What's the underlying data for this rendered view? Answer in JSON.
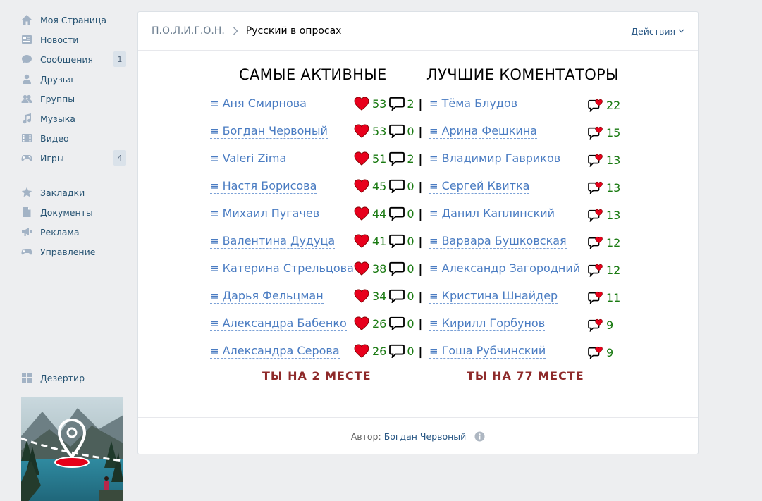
{
  "sidebar": {
    "items": [
      {
        "label": "Моя Страница",
        "icon": "home-icon"
      },
      {
        "label": "Новости",
        "icon": "news-icon"
      },
      {
        "label": "Сообщения",
        "icon": "messages-icon",
        "count": "1"
      },
      {
        "label": "Друзья",
        "icon": "friends-icon"
      },
      {
        "label": "Группы",
        "icon": "groups-icon"
      },
      {
        "label": "Музыка",
        "icon": "music-icon"
      },
      {
        "label": "Видео",
        "icon": "video-icon"
      },
      {
        "label": "Игры",
        "icon": "games-icon",
        "count": "4"
      }
    ],
    "items2": [
      {
        "label": "Закладки",
        "icon": "bookmarks-icon"
      },
      {
        "label": "Документы",
        "icon": "documents-icon"
      },
      {
        "label": "Реклама",
        "icon": "ads-icon"
      },
      {
        "label": "Управление",
        "icon": "manage-icon"
      }
    ],
    "app": {
      "label": "Дезертир",
      "icon": "apps-icon"
    }
  },
  "header": {
    "breadcrumb_parent": "П.О.Л.И.Г.О.Н.",
    "title": "Русский в опросах",
    "actions_label": "Действия"
  },
  "columns": {
    "active_title": "САМЫЕ АКТИВНЫЕ",
    "commenters_title": "ЛУЧШИЕ КОМЕНТАТОРЫ"
  },
  "active": [
    {
      "name": "Аня Смирнова",
      "likes": "53",
      "comments": "2"
    },
    {
      "name": "Богдан Червоный",
      "likes": "53",
      "comments": "0"
    },
    {
      "name": "Valeri Zima",
      "likes": "51",
      "comments": "2"
    },
    {
      "name": "Настя Борисова",
      "likes": "45",
      "comments": "0"
    },
    {
      "name": "Михаил Пугачев",
      "likes": "44",
      "comments": "0"
    },
    {
      "name": "Валентина Дудуца",
      "likes": "41",
      "comments": "0"
    },
    {
      "name": "Катерина Стрельцова",
      "likes": "38",
      "comments": "0"
    },
    {
      "name": "Дарья Фельцман",
      "likes": "34",
      "comments": "0"
    },
    {
      "name": "Александра Бабенко",
      "likes": "26",
      "comments": "0"
    },
    {
      "name": "Александра Серова",
      "likes": "26",
      "comments": "0"
    }
  ],
  "commenters": [
    {
      "name": "Тёма Блудов",
      "score": "22"
    },
    {
      "name": "Арина Фешкина",
      "score": "15"
    },
    {
      "name": "Владимир Гавриков",
      "score": "13"
    },
    {
      "name": "Сергей Квитка",
      "score": "13"
    },
    {
      "name": "Данил Каплинский",
      "score": "13"
    },
    {
      "name": "Варвара Бушковская",
      "score": "12"
    },
    {
      "name": "Александр Загородний",
      "score": "12"
    },
    {
      "name": "Кристина Шнайдер",
      "score": "11"
    },
    {
      "name": "Кирилл Горбунов",
      "score": "9"
    },
    {
      "name": "Гоша Рубчинский",
      "score": "9"
    }
  ],
  "places": {
    "active_place": "ТЫ НА 2 МЕСТЕ",
    "commenters_place": "ТЫ НА 77 МЕСТЕ"
  },
  "footer": {
    "author_label": "Автор:",
    "author_name": "Богдан Червоный"
  },
  "row_separator": "|",
  "hamburger": "≡",
  "colors": {
    "link": "#4a7cc2",
    "number_green": "#1a7a12",
    "heart_red": "#e8001c",
    "place_red": "#8e2a2a",
    "sidebar_text": "#285473",
    "background": "#edeef0"
  }
}
